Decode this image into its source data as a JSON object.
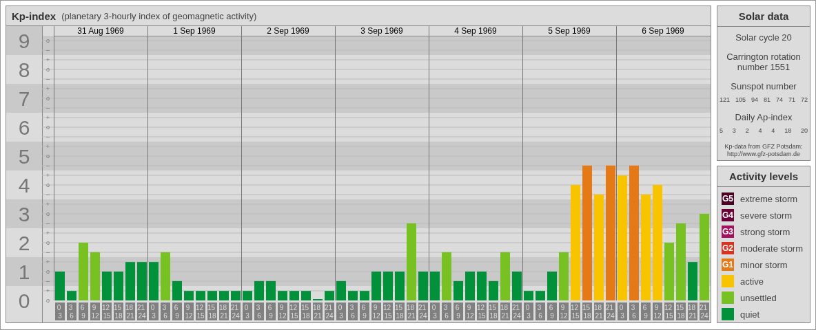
{
  "title": {
    "name": "Kp-index",
    "subtitle": "(planetary 3-hourly index of geomagnetic activity)"
  },
  "chart": {
    "days": [
      "31 Aug 1969",
      "1 Sep 1969",
      "2 Sep 1969",
      "3 Sep 1969",
      "4 Sep 1969",
      "5 Sep 1969",
      "6 Sep 1969"
    ],
    "minor_tick_labels": [
      "o",
      "–",
      "+",
      "o",
      "–",
      "+",
      "o",
      "–",
      "+",
      "o",
      "–",
      "+",
      "o",
      "–",
      "+",
      "o",
      "–",
      "+",
      "o",
      "–",
      "+",
      "o",
      "–",
      "+",
      "o",
      "–",
      "+",
      "o"
    ],
    "chart_data": {
      "type": "bar",
      "ylim": [
        0,
        9
      ],
      "grid": true,
      "yticks": [
        0,
        1,
        2,
        3,
        4,
        5,
        6,
        7,
        8,
        9
      ],
      "categories": [
        "0 3",
        "3 6",
        "6 9",
        "9 12",
        "12 15",
        "15 18",
        "18 21",
        "21 24",
        "0 3",
        "3 6",
        "6 9",
        "9 12",
        "12 15",
        "15 18",
        "18 21",
        "21 24",
        "0 3",
        "3 6",
        "6 9",
        "9 12",
        "12 15",
        "15 18",
        "18 21",
        "21 24",
        "0 3",
        "3 6",
        "6 9",
        "9 12",
        "12 15",
        "15 18",
        "18 21",
        "21 24",
        "0 3",
        "3 6",
        "6 9",
        "9 12",
        "12 15",
        "15 18",
        "18 21",
        "21 24",
        "0 3",
        "3 6",
        "6 9",
        "9 12",
        "12 15",
        "15 18",
        "18 21",
        "21 24",
        "0 3",
        "3 6",
        "6 9",
        "9 12",
        "12 15",
        "15 18",
        "18 21",
        "21 24"
      ],
      "values": [
        1,
        0.33,
        2,
        1.67,
        1,
        1,
        1.33,
        1.33,
        1.33,
        1.67,
        0.67,
        0.33,
        0.33,
        0.33,
        0.33,
        0.33,
        0.33,
        0.67,
        0.67,
        0.33,
        0.33,
        0.33,
        0,
        0.33,
        0.67,
        0.33,
        0.33,
        1,
        1,
        1,
        2.67,
        1,
        1,
        1.67,
        0.67,
        1,
        1,
        0.67,
        1.67,
        1,
        0.33,
        0.33,
        1,
        1.67,
        4,
        4.67,
        3.67,
        4.67,
        4.33,
        4.67,
        3.67,
        4,
        2,
        2.67,
        1.33,
        3
      ]
    }
  },
  "solar": {
    "title": "Solar data",
    "cycle": "Solar cycle 20",
    "rotation": "Carrington rotation number 1551",
    "sunspot_title": "Sunspot number",
    "sunspots": [
      "121",
      "105",
      "94",
      "81",
      "74",
      "71",
      "72"
    ],
    "ap_title": "Daily Ap-index",
    "ap": [
      "5",
      "3",
      "2",
      "4",
      "4",
      "18",
      "20"
    ],
    "source": "Kp-data from GFZ Potsdam:",
    "source_url": "http://www.gfz-potsdam.de"
  },
  "legend": {
    "title": "Activity levels",
    "items": [
      {
        "badge": "G5",
        "label": "extreme storm",
        "color": "#4a0022"
      },
      {
        "badge": "G4",
        "label": "severe storm",
        "color": "#6b0036"
      },
      {
        "badge": "G3",
        "label": "strong storm",
        "color": "#a3125f"
      },
      {
        "badge": "G2",
        "label": "moderate storm",
        "color": "#d9321e"
      },
      {
        "badge": "G1",
        "label": "minor storm",
        "color": "#e47916"
      },
      {
        "label": "active",
        "color": "#f8c400"
      },
      {
        "label": "unsettled",
        "color": "#77c122"
      },
      {
        "label": "quiet",
        "color": "#00913a"
      }
    ]
  }
}
